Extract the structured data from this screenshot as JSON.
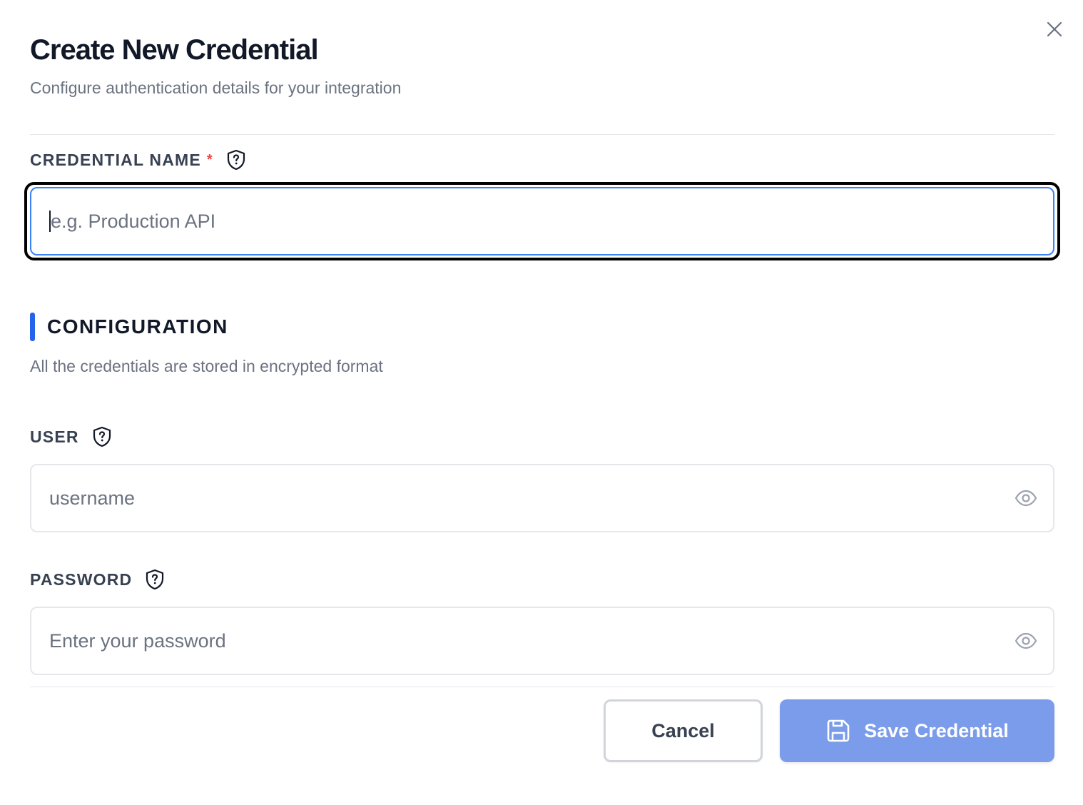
{
  "dialog": {
    "title": "Create New Credential",
    "subtitle": "Configure authentication details for your integration"
  },
  "credential_name": {
    "label": "CREDENTIAL NAME",
    "required_mark": "*",
    "placeholder": "e.g. Production API",
    "value": "",
    "help_icon": "shield-question-icon"
  },
  "configuration": {
    "title": "CONFIGURATION",
    "description": "All the credentials are stored in encrypted format",
    "accent_color": "#2563eb"
  },
  "user": {
    "label": "USER",
    "placeholder": "username",
    "value": "",
    "help_icon": "shield-question-icon",
    "toggle_icon": "eye-icon"
  },
  "password": {
    "label": "PASSWORD",
    "placeholder": "Enter your password",
    "value": "",
    "help_icon": "shield-question-icon",
    "toggle_icon": "eye-icon"
  },
  "actions": {
    "cancel_label": "Cancel",
    "save_label": "Save Credential",
    "save_icon": "save-icon",
    "save_color": "#7b9cea",
    "save_enabled": false
  },
  "close_icon": "close-icon",
  "colors": {
    "required": "#ef4444",
    "focus_border": "#3b82f6"
  }
}
